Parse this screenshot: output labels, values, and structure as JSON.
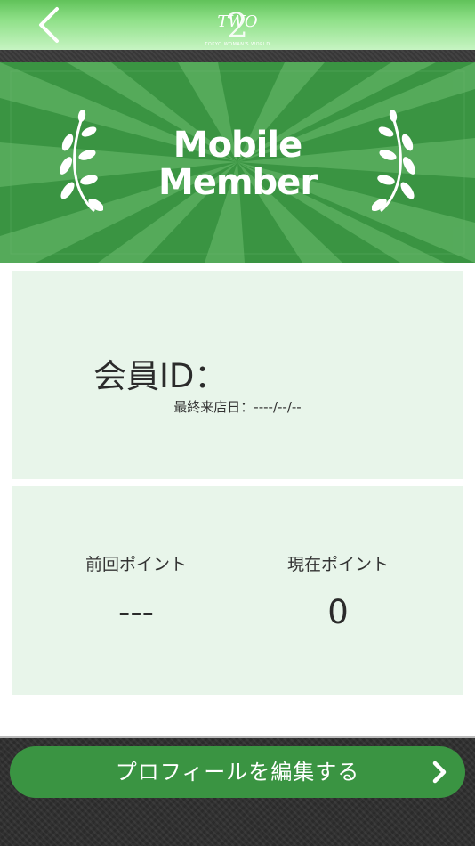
{
  "header": {
    "logo_text": "TWO",
    "logo_numeral": "2",
    "logo_subtext": "TOKYO WOMAN'S WORLD",
    "back_icon": "chevron-left-icon"
  },
  "banner": {
    "title_line1": "Mobile",
    "title_line2": "Member",
    "icon": "laurel-icon"
  },
  "member": {
    "id_label": "会員ID：",
    "last_visit_label": "最終来店日：",
    "last_visit_value": "----/--/--"
  },
  "points": {
    "previous_label": "前回ポイント",
    "previous_value": "---",
    "current_label": "現在ポイント",
    "current_value": "0"
  },
  "footer": {
    "edit_profile_label": "プロフィールを編集する",
    "chevron_icon": "chevron-right-icon"
  },
  "colors": {
    "header_green": "#8fe088",
    "banner_green": "#3a9442",
    "card_bg": "#e8f5ea",
    "button_green": "#3a9442",
    "footer_dark": "#2f2f2f"
  }
}
